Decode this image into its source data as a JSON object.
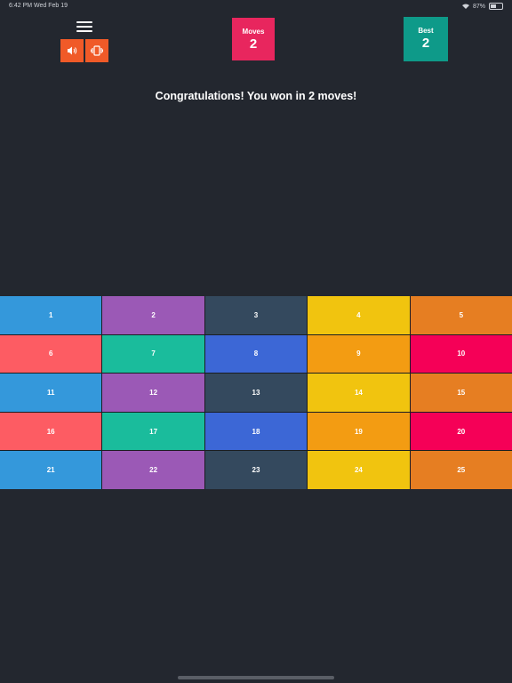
{
  "status_bar": {
    "time": "6:42 PM   Wed Feb 19",
    "battery": "87%"
  },
  "controls": {
    "menu_icon": "hamburger-menu-icon",
    "sound_icon": "speaker-icon",
    "vibrate_icon": "vibrate-icon",
    "accent": "#f05a28"
  },
  "score": {
    "moves_label": "Moves",
    "moves_value": "2",
    "best_label": "Best",
    "best_value": "2"
  },
  "message": "Congratulations! You won in 2 moves!",
  "board": {
    "tiles": [
      {
        "label": "1",
        "color": "#3498db"
      },
      {
        "label": "2",
        "color": "#9b59b6"
      },
      {
        "label": "3",
        "color": "#34495e"
      },
      {
        "label": "4",
        "color": "#f1c40f"
      },
      {
        "label": "5",
        "color": "#e67e22"
      },
      {
        "label": "6",
        "color": "#fd5c63"
      },
      {
        "label": "7",
        "color": "#1abc9c"
      },
      {
        "label": "8",
        "color": "#3c67d6"
      },
      {
        "label": "9",
        "color": "#f39c12"
      },
      {
        "label": "10",
        "color": "#f50057"
      },
      {
        "label": "11",
        "color": "#3498db"
      },
      {
        "label": "12",
        "color": "#9b59b6"
      },
      {
        "label": "13",
        "color": "#34495e"
      },
      {
        "label": "14",
        "color": "#f1c40f"
      },
      {
        "label": "15",
        "color": "#e67e22"
      },
      {
        "label": "16",
        "color": "#fd5c63"
      },
      {
        "label": "17",
        "color": "#1abc9c"
      },
      {
        "label": "18",
        "color": "#3c67d6"
      },
      {
        "label": "19",
        "color": "#f39c12"
      },
      {
        "label": "20",
        "color": "#f50057"
      },
      {
        "label": "21",
        "color": "#3498db"
      },
      {
        "label": "22",
        "color": "#9b59b6"
      },
      {
        "label": "23",
        "color": "#34495e"
      },
      {
        "label": "24",
        "color": "#f1c40f"
      },
      {
        "label": "25",
        "color": "#e67e22"
      }
    ]
  }
}
